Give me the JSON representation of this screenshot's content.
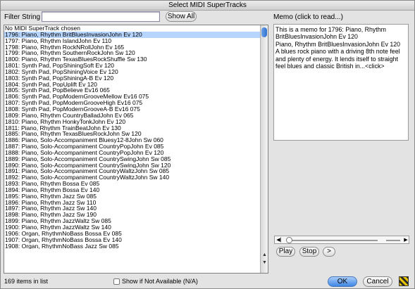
{
  "window": {
    "title": "Select MIDI SuperTracks"
  },
  "filter": {
    "label": "Filter String",
    "value": "",
    "show_all_label": "Show All"
  },
  "list": {
    "selected_index": 1,
    "items": [
      "No MIDI SuperTrack chosen",
      "1796: Piano, Rhythm BritBluesInvasionJohn Ev 120",
      "1797: Piano, Rhythm IslandJohn Ev 110",
      "1798: Piano, Rhythm RockNRollJohn Ev 165",
      "1799: Piano, Rhythm SouthernRockJohn Sw 120",
      "1800: Piano, Rhythm TexasBluesRockShuffle Sw 130",
      "1801: Synth Pad, PopShiningSoft Ev 120",
      "1802: Synth Pad, PopShiningVoice Ev 120",
      "1803: Synth Pad, PopShiningA-B Ev 120",
      "1804: Synth Pad, PopUplift Ev 120",
      "1805: Synth Pad, PopBelieve Ev16 065",
      "1806: Synth Pad, PopModernGrooveMellow Ev16 075",
      "1807: Synth Pad, PopModernGrooveHigh Ev16 075",
      "1808: Synth Pad, PopModernGrooveA-B Ev16 075",
      "1809: Piano, Rhythm CountryBalladJohn Ev 065",
      "1810: Piano, Rhythm HonkyTonkJohn Ev 120",
      "1811: Piano, Rhythm TrainBeatJohn Ev 130",
      "1885: Piano, Rhythm TexasBluesRockJohn Sw 120",
      "1886: Piano, Solo-Accompaniment Bluesy12-8John Sw 060",
      "1887: Piano, Solo-Accompaniment CountryPopJohn Ev 085",
      "1888: Piano, Solo-Accompaniment CountryPopJohn Ev 120",
      "1889: Piano, Solo-Accompaniment CountrySwingJohn Sw 085",
      "1890: Piano, Solo-Accompaniment CountrySwingJohn Sw 120",
      "1891: Piano, Solo-Accompaniment CountryWaltzJohn Sw 085",
      "1892: Piano, Solo-Accompaniment CountryWaltzJohn Sw 140",
      "1893: Piano, Rhythm Bossa Ev 085",
      "1894: Piano, Rhythm Bossa Ev 140",
      "1895: Piano, Rhythm Jazz Sw 085",
      "1896: Piano, Rhythm Jazz Sw 110",
      "1897: Piano, Rhythm Jazz Sw 140",
      "1898: Piano, Rhythm Jazz Sw 190",
      "1899: Piano, Rhythm JazzWaltz Sw 085",
      "1900: Piano, Rhythm JazzWaltz Sw 140",
      "1906: Organ, RhythmNoBass Bossa Ev 085",
      "1907: Organ, RhythmNoBass Bossa Ev 140",
      "1908: Organ, RhythmNoBass Jazz Sw 085"
    ]
  },
  "status": {
    "count_text": "169 items in list",
    "show_na_label": "Show if Not Available (N/A)"
  },
  "memo": {
    "label": "Memo (click to read...)",
    "lines": [
      "This is a memo for 1796: Piano, Rhythm",
      "BritBluesInvasionJohn Ev 120",
      "Piano, Rhythm BritBluesInvasionJohn Ev 120",
      "A blues rock piano with a driving 8th note feel",
      "and plenty of energy.  It lends itself to straight",
      "feel blues and classic British in...<click>"
    ]
  },
  "player": {
    "play_label": "Play",
    "stop_label": "Stop",
    "next_label": ">",
    "position_fraction": 0.0
  },
  "footer": {
    "ok_label": "OK",
    "cancel_label": "Cancel"
  },
  "colors": {
    "selection": "#b5d5ff",
    "default_button": "#3d86e4"
  }
}
